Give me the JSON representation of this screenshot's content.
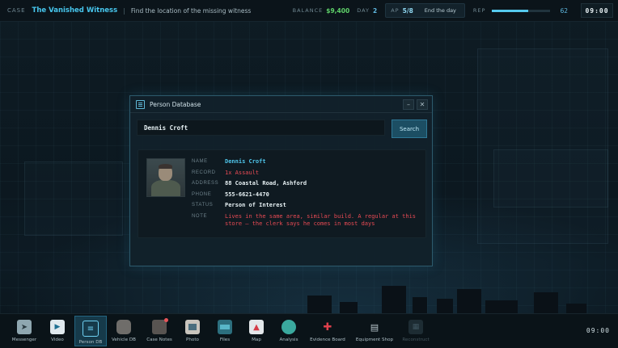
{
  "topbar": {
    "case_label": "CASE",
    "case_title": "The Vanished Witness",
    "separator": "|",
    "objective": "Find the location of the missing witness",
    "balance_label": "BALANCE",
    "balance_value": "$9,400",
    "day_label": "DAY",
    "day_value": "2",
    "ap_label": "AP",
    "ap_value": "5/8",
    "end_day_label": "End the day",
    "rep_label": "REP",
    "rep_value": "62",
    "rep_fraction": 0.62,
    "clock": "09:00",
    "colors": {
      "accent": "#47c7ee",
      "money": "#5fd36a",
      "day": "#5fb8e0"
    }
  },
  "window": {
    "title": "Person Database",
    "icon": "database-icon",
    "minimize_label": "–",
    "close_label": "✕",
    "search": {
      "value": "Dennis Croft",
      "button_label": "Search"
    },
    "result": {
      "photo_icon": "portrait-photo",
      "fields": [
        {
          "label": "NAME",
          "value": "Dennis Croft",
          "style": "cyan"
        },
        {
          "label": "RECORD",
          "value": "1x Assault",
          "style": "red"
        },
        {
          "label": "ADDRESS",
          "value": "88 Coastal Road, Ashford",
          "style": "plain"
        },
        {
          "label": "PHONE",
          "value": "555-6621-4470",
          "style": "plain"
        },
        {
          "label": "STATUS",
          "value": "Person of Interest",
          "style": "plain"
        },
        {
          "label": "NOTE",
          "value": "Lives in the same area, similar build. A regular at this store — the clerk says he comes in most days",
          "style": "note"
        }
      ]
    }
  },
  "taskbar": {
    "items": [
      {
        "label": "Messenger",
        "icon": "messenger-icon"
      },
      {
        "label": "Video",
        "icon": "video-icon"
      },
      {
        "label": "Person DB",
        "icon": "database-icon",
        "active": true
      },
      {
        "label": "Vehicle DB",
        "icon": "car-icon"
      },
      {
        "label": "Case Notes",
        "icon": "notes-icon",
        "badge": true
      },
      {
        "label": "Photo",
        "icon": "photo-icon"
      },
      {
        "label": "Files",
        "icon": "files-icon"
      },
      {
        "label": "Map",
        "icon": "map-icon"
      },
      {
        "label": "Analysis",
        "icon": "analysis-icon"
      },
      {
        "label": "Evidence Board",
        "icon": "pin-icon"
      },
      {
        "label": "Equipment Shop",
        "icon": "shop-icon"
      },
      {
        "label": "Reconstruct",
        "icon": "reconstruct-icon",
        "disabled": true
      }
    ],
    "clock": "09:00"
  }
}
